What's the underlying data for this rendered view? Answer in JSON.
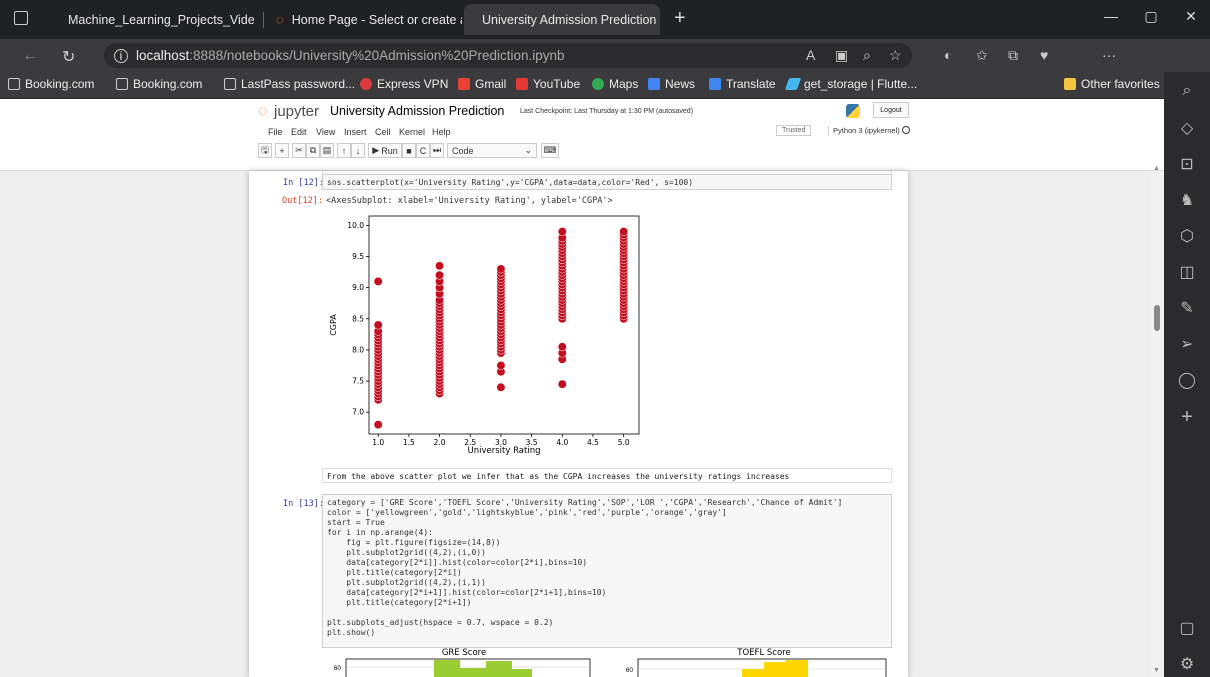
{
  "browser": {
    "tabs": [
      {
        "label": "Machine_Learning_Projects_Vide",
        "active": false
      },
      {
        "label": "Home Page - Select or create a n",
        "active": false
      },
      {
        "label": "University Admission Prediction",
        "active": true
      }
    ],
    "url_host": "localhost",
    "url_rest": ":8888/notebooks/University%20Admission%20Prediction.ipynb",
    "favorites": [
      "Booking.com",
      "Booking.com",
      "LastPass password...",
      "Express VPN",
      "Gmail",
      "YouTube",
      "Maps",
      "News",
      "Translate",
      "get_storage | Flutte..."
    ],
    "other_favorites": "Other favorites"
  },
  "jupyter": {
    "logo": "jupyter",
    "title": "University Admission Prediction",
    "checkpoint": "Last Checkpoint: Last Thursday at 1:30 PM  (autosaved)",
    "logout": "Logout",
    "menu": [
      "File",
      "Edit",
      "View",
      "Insert",
      "Cell",
      "Kernel",
      "Help"
    ],
    "trusted": "Trusted",
    "kernel": "Python 3 (ipykernel)",
    "run_label": "Run",
    "cell_type": "Code"
  },
  "cells": {
    "c12_prompt": "In [12]:",
    "c12_code": "sns.scatterplot(x='University Rating',y='CGPA',data=data,color='Red', s=100)",
    "c12_out_prompt": "Out[12]:",
    "c12_out": "<AxesSubplot: xlabel='University Rating', ylabel='CGPA'>",
    "md_text": "From the above scatter plot we infer that as the CGPA increases the university ratings increases",
    "c13_prompt": "In [13]:",
    "c13_code": "category = ['GRE Score','TOEFL Score','University Rating','SOP','LOR ','CGPA','Research','Chance of Admit']\ncolor = ['yellowgreen','gold','lightskyblue','pink','red','purple','orange','gray']\nstart = True\nfor i in np.arange(4):\n    fig = plt.figure(figsize=(14,8))\n    plt.subplot2grid((4,2),(i,0))\n    data[category[2*i]].hist(color=color[2*i],bins=10)\n    plt.title(category[2*i])\n    plt.subplot2grid((4,2),(i,1))\n    data[category[2*i+1]].hist(color=color[2*i+1],bins=10)\n    plt.title(category[2*i+1])\n\nplt.subplots_adjust(hspace = 0.7, wspace = 0.2)\nplt.show()"
  },
  "colors": {
    "scatter": "#c40d1e",
    "green": "#9acd32",
    "gold": "#ffd700"
  },
  "chart_data": [
    {
      "type": "scatter",
      "xlabel": "University Rating",
      "ylabel": "CGPA",
      "xlim": [
        0.85,
        5.25
      ],
      "ylim": [
        6.65,
        10.15
      ],
      "xticks": [
        "1.0",
        "1.5",
        "2.0",
        "2.5",
        "3.0",
        "3.5",
        "4.0",
        "4.5",
        "5.0"
      ],
      "yticks": [
        "7.0",
        "7.5",
        "8.0",
        "8.5",
        "9.0",
        "9.5",
        "10.0"
      ],
      "series": [
        {
          "x": 1,
          "y": [
            6.8,
            7.2,
            7.25,
            7.3,
            7.35,
            7.4,
            7.45,
            7.5,
            7.55,
            7.6,
            7.65,
            7.7,
            7.75,
            7.8,
            7.85,
            7.9,
            7.95,
            8.0,
            8.05,
            8.1,
            8.15,
            8.2,
            8.25,
            8.3,
            8.4,
            9.1
          ]
        },
        {
          "x": 2,
          "y": [
            7.3,
            7.35,
            7.4,
            7.45,
            7.5,
            7.55,
            7.6,
            7.65,
            7.7,
            7.75,
            7.8,
            7.85,
            7.9,
            7.95,
            8.0,
            8.05,
            8.1,
            8.15,
            8.2,
            8.25,
            8.3,
            8.35,
            8.4,
            8.45,
            8.5,
            8.55,
            8.6,
            8.65,
            8.7,
            8.75,
            8.8,
            8.9,
            9.0,
            9.1,
            9.2,
            9.35
          ]
        },
        {
          "x": 3,
          "y": [
            7.4,
            7.65,
            7.75,
            7.95,
            8.0,
            8.05,
            8.1,
            8.15,
            8.2,
            8.25,
            8.3,
            8.35,
            8.4,
            8.45,
            8.5,
            8.55,
            8.6,
            8.65,
            8.7,
            8.75,
            8.8,
            8.85,
            8.9,
            8.95,
            9.0,
            9.05,
            9.1,
            9.15,
            9.2,
            9.25,
            9.3
          ]
        },
        {
          "x": 4,
          "y": [
            7.45,
            7.85,
            7.95,
            8.05,
            8.5,
            8.55,
            8.6,
            8.65,
            8.7,
            8.75,
            8.8,
            8.85,
            8.9,
            8.95,
            9.0,
            9.05,
            9.1,
            9.15,
            9.2,
            9.25,
            9.3,
            9.35,
            9.4,
            9.45,
            9.5,
            9.55,
            9.6,
            9.65,
            9.7,
            9.75,
            9.8,
            9.9
          ]
        },
        {
          "x": 5,
          "y": [
            8.5,
            8.55,
            8.6,
            8.65,
            8.7,
            8.75,
            8.8,
            8.85,
            8.9,
            8.95,
            9.0,
            9.05,
            9.1,
            9.15,
            9.2,
            9.25,
            9.3,
            9.35,
            9.4,
            9.45,
            9.5,
            9.55,
            9.6,
            9.65,
            9.7,
            9.75,
            9.8,
            9.85,
            9.9
          ]
        }
      ]
    },
    {
      "type": "bar",
      "title": "GRE Score",
      "ytick": "60",
      "color": "yellowgreen"
    },
    {
      "type": "bar",
      "title": "TOEFL Score",
      "ytick": "60",
      "color": "gold"
    }
  ]
}
